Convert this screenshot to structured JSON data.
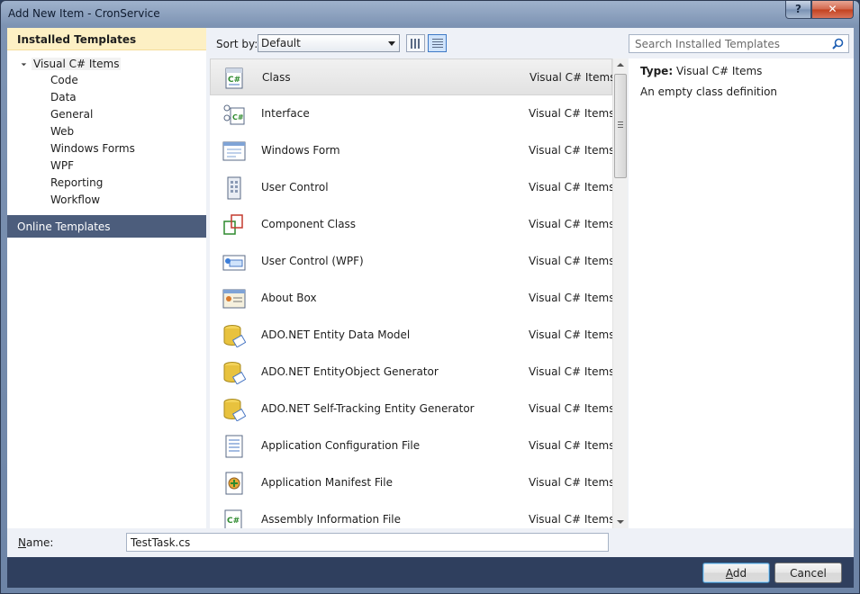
{
  "window": {
    "title": "Add New Item - CronService",
    "help_label": "?",
    "close_label": "✕"
  },
  "left": {
    "installed_header": "Installed Templates",
    "tree_root": "Visual C# Items",
    "tree_children": [
      "Code",
      "Data",
      "General",
      "Web",
      "Windows Forms",
      "WPF",
      "Reporting",
      "Workflow"
    ],
    "online_header": "Online Templates"
  },
  "toolbar": {
    "sort_label": "Sort by:",
    "sort_value": "Default"
  },
  "items": [
    {
      "name": "Class",
      "category": "Visual C# Items",
      "icon": "cs-class-icon"
    },
    {
      "name": "Interface",
      "category": "Visual C# Items",
      "icon": "cs-interface-icon"
    },
    {
      "name": "Windows Form",
      "category": "Visual C# Items",
      "icon": "windows-form-icon"
    },
    {
      "name": "User Control",
      "category": "Visual C# Items",
      "icon": "user-control-icon"
    },
    {
      "name": "Component Class",
      "category": "Visual C# Items",
      "icon": "component-class-icon"
    },
    {
      "name": "User Control (WPF)",
      "category": "Visual C# Items",
      "icon": "wpf-user-control-icon"
    },
    {
      "name": "About Box",
      "category": "Visual C# Items",
      "icon": "about-box-icon"
    },
    {
      "name": "ADO.NET Entity Data Model",
      "category": "Visual C# Items",
      "icon": "database-icon"
    },
    {
      "name": "ADO.NET EntityObject Generator",
      "category": "Visual C# Items",
      "icon": "database-icon"
    },
    {
      "name": "ADO.NET Self-Tracking Entity Generator",
      "category": "Visual C# Items",
      "icon": "database-icon"
    },
    {
      "name": "Application Configuration File",
      "category": "Visual C# Items",
      "icon": "config-file-icon"
    },
    {
      "name": "Application Manifest File",
      "category": "Visual C# Items",
      "icon": "manifest-file-icon"
    },
    {
      "name": "Assembly Information File",
      "category": "Visual C# Items",
      "icon": "cs-file-icon"
    }
  ],
  "search": {
    "placeholder": "Search Installed Templates"
  },
  "info": {
    "type_label": "Type:",
    "type_value": "Visual C# Items",
    "description": "An empty class definition"
  },
  "name_field": {
    "label_underlined": "N",
    "label_rest": "ame:",
    "value": "TestTask.cs"
  },
  "buttons": {
    "add_underlined": "A",
    "add_rest": "dd",
    "cancel": "Cancel"
  }
}
